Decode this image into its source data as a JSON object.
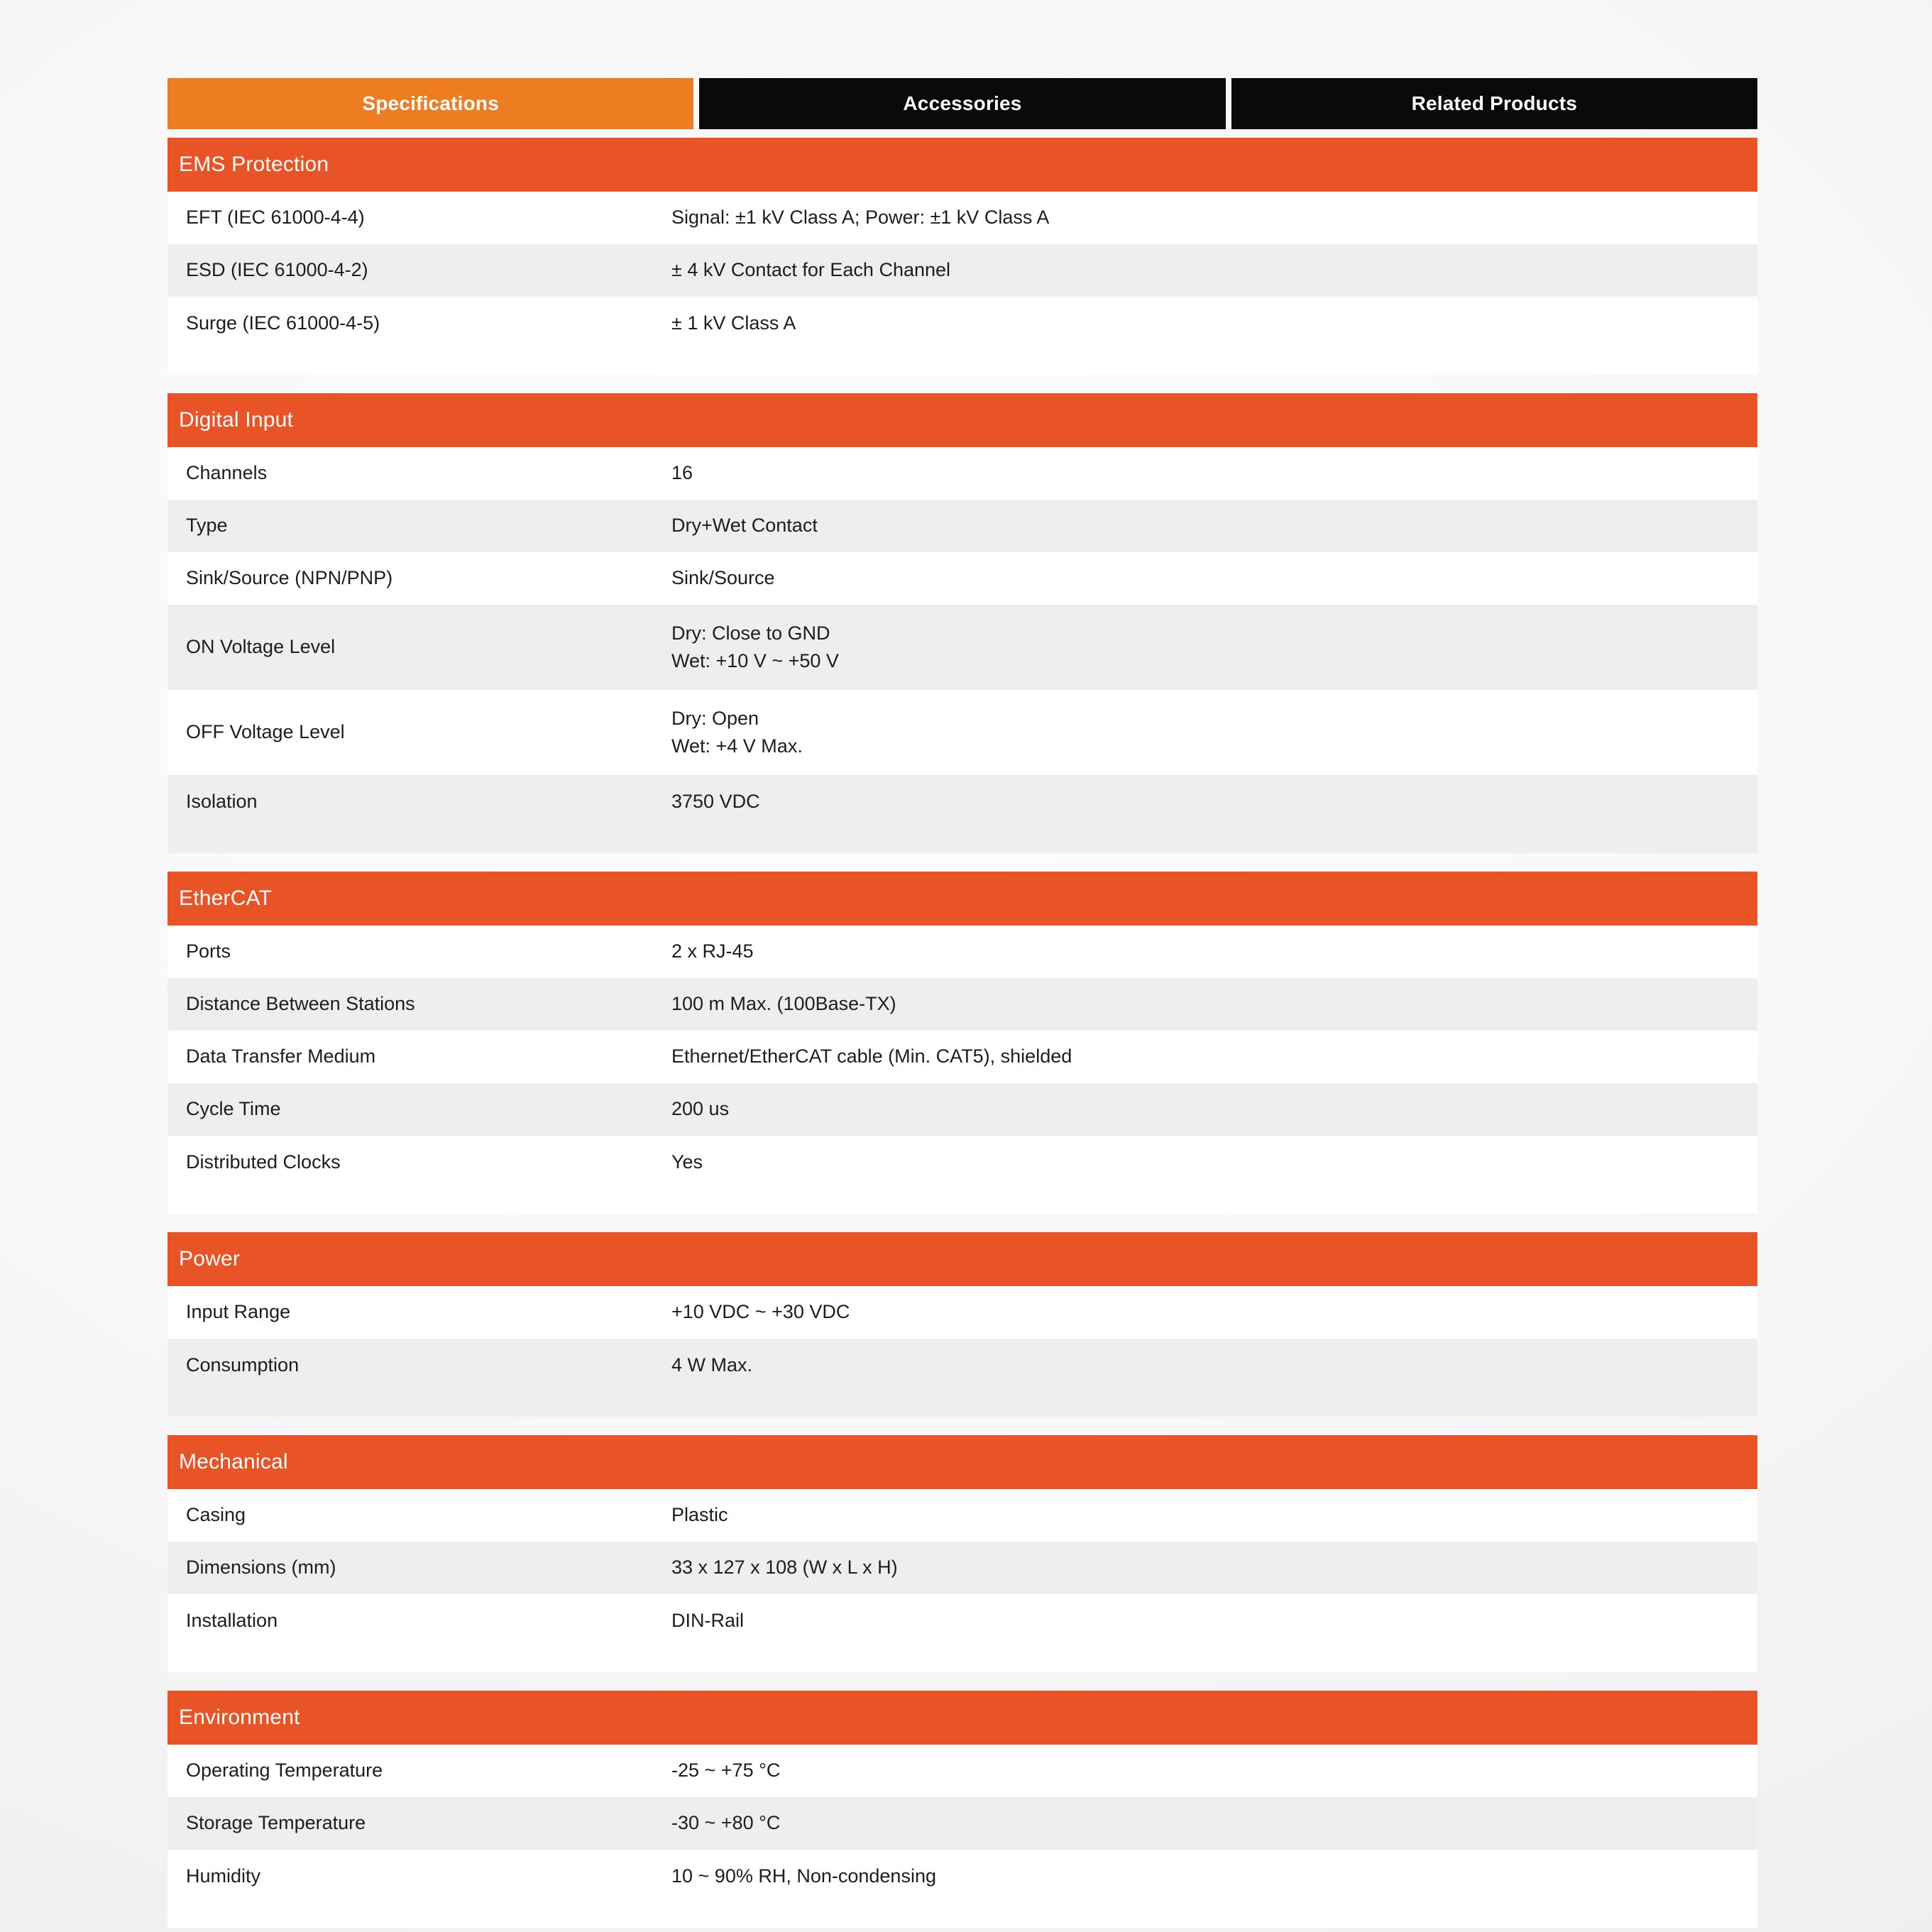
{
  "tabs": [
    {
      "label": "Specifications",
      "active": true
    },
    {
      "label": "Accessories",
      "active": false
    },
    {
      "label": "Related Products",
      "active": false
    }
  ],
  "groups": [
    {
      "title": "EMS Protection",
      "rows": [
        {
          "label": "EFT (IEC 61000-4-4)",
          "value": "Signal: ±1 kV Class A; Power: ±1 kV Class A"
        },
        {
          "label": "ESD (IEC 61000-4-2)",
          "value": "± 4 kV Contact for Each Channel"
        },
        {
          "label": "Surge (IEC 61000-4-5)",
          "value": "± 1 kV Class A"
        }
      ]
    },
    {
      "title": "Digital Input",
      "rows": [
        {
          "label": "Channels",
          "value": "16"
        },
        {
          "label": "Type",
          "value": "Dry+Wet Contact"
        },
        {
          "label": "Sink/Source (NPN/PNP)",
          "value": "Sink/Source"
        },
        {
          "label": "ON Voltage Level",
          "value": "Dry: Close to GND\nWet: +10 V ~ +50 V"
        },
        {
          "label": "OFF Voltage Level",
          "value": "Dry: Open\nWet: +4 V Max."
        },
        {
          "label": "Isolation",
          "value": "3750 VDC"
        }
      ]
    },
    {
      "title": "EtherCAT",
      "rows": [
        {
          "label": "Ports",
          "value": "2 x RJ-45"
        },
        {
          "label": "Distance Between Stations",
          "value": "100 m Max. (100Base-TX)"
        },
        {
          "label": "Data Transfer Medium",
          "value": "Ethernet/EtherCAT cable (Min. CAT5), shielded"
        },
        {
          "label": "Cycle Time",
          "value": "200 us"
        },
        {
          "label": "Distributed Clocks",
          "value": "Yes"
        }
      ]
    },
    {
      "title": "Power",
      "rows": [
        {
          "label": "Input Range",
          "value": "+10 VDC ~ +30 VDC"
        },
        {
          "label": "Consumption",
          "value": "4 W Max."
        }
      ]
    },
    {
      "title": "Mechanical",
      "rows": [
        {
          "label": "Casing",
          "value": "Plastic"
        },
        {
          "label": "Dimensions (mm)",
          "value": "33 x 127 x 108 (W x L x H)"
        },
        {
          "label": "Installation",
          "value": "DIN-Rail"
        }
      ]
    },
    {
      "title": "Environment",
      "rows": [
        {
          "label": "Operating Temperature",
          "value": "-25 ~ +75 °C"
        },
        {
          "label": "Storage Temperature",
          "value": "-30 ~ +80 °C"
        },
        {
          "label": "Humidity",
          "value": "10 ~ 90% RH, Non-condensing"
        }
      ]
    }
  ],
  "colors": {
    "tab_active": "#ee7d22",
    "tab_inactive": "#0a0a0a",
    "group_header": "#e85426",
    "row_alt": "#eeeeee",
    "row_base": "#ffffff",
    "page_bg": "#f7f7f8",
    "text": "#1d1d1f"
  }
}
